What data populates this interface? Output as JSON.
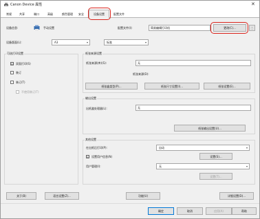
{
  "window": {
    "title": "Canon Device 属性"
  },
  "tabs": [
    {
      "label": "常规"
    },
    {
      "label": "共享"
    },
    {
      "label": "端口"
    },
    {
      "label": "高级"
    },
    {
      "label": "颜色管理"
    },
    {
      "label": "安全"
    },
    {
      "label": "设备设置"
    },
    {
      "label": "配置文件"
    }
  ],
  "device": {
    "info_label": "设备信息:",
    "mode_label": "手动设置",
    "profile_label": "配置文件(I):",
    "profile_value": "简易编辑打印机",
    "change_button": "更改(C)...",
    "size_label": "设备版面(L):",
    "size_value": "A3",
    "size2_value": "标准"
  },
  "output_options": {
    "title": "可选打印设置",
    "duplex": {
      "label": "双面打印(S)",
      "checked": "☑"
    },
    "staple": {
      "label": "装订"
    },
    "tray": {
      "label": "装订(T)"
    },
    "tray_sub": {
      "label": "不使用装订(T)"
    }
  },
  "paper_source": {
    "title": "纸张来源设置",
    "source_label": "纸张来源(库)(S):",
    "source_value": "无",
    "tray_label": "纸张来源(D):",
    "btn_paper_type": "纸张盒类型(P)...",
    "btn_paper_size": "纸张尺寸设置(I)...",
    "btn_special": "纸张设置(E)..."
  },
  "output_settings": {
    "title": "输出设置",
    "output_label": "出纸盒处理器(L):",
    "output_value": "无",
    "btn_output": "纸张输出设置(U)..."
  },
  "other_settings": {
    "title": "其他设置",
    "auto_label": "在出纸后打印(P):",
    "auto_value": "自动",
    "user_info": {
      "label": "设置用户信息(N)",
      "checked": "☑"
    },
    "user_info_btn": "设置(S)...",
    "user_mgmt_label": "用户管理(I):",
    "user_mgmt_value": "无",
    "user_mgmt_btn": "设置(T)..."
  },
  "bottom": {
    "about": "关于(B)",
    "lang": "语言设置(Z)...",
    "features": "功能(U)",
    "detailed": "详细设置(D)...",
    "ok": "确定",
    "cancel": "取消",
    "apply": "应用(A)",
    "help": "帮助"
  },
  "colors": {
    "highlight": "#d9241c",
    "window_bg": "#f0f0f0"
  }
}
